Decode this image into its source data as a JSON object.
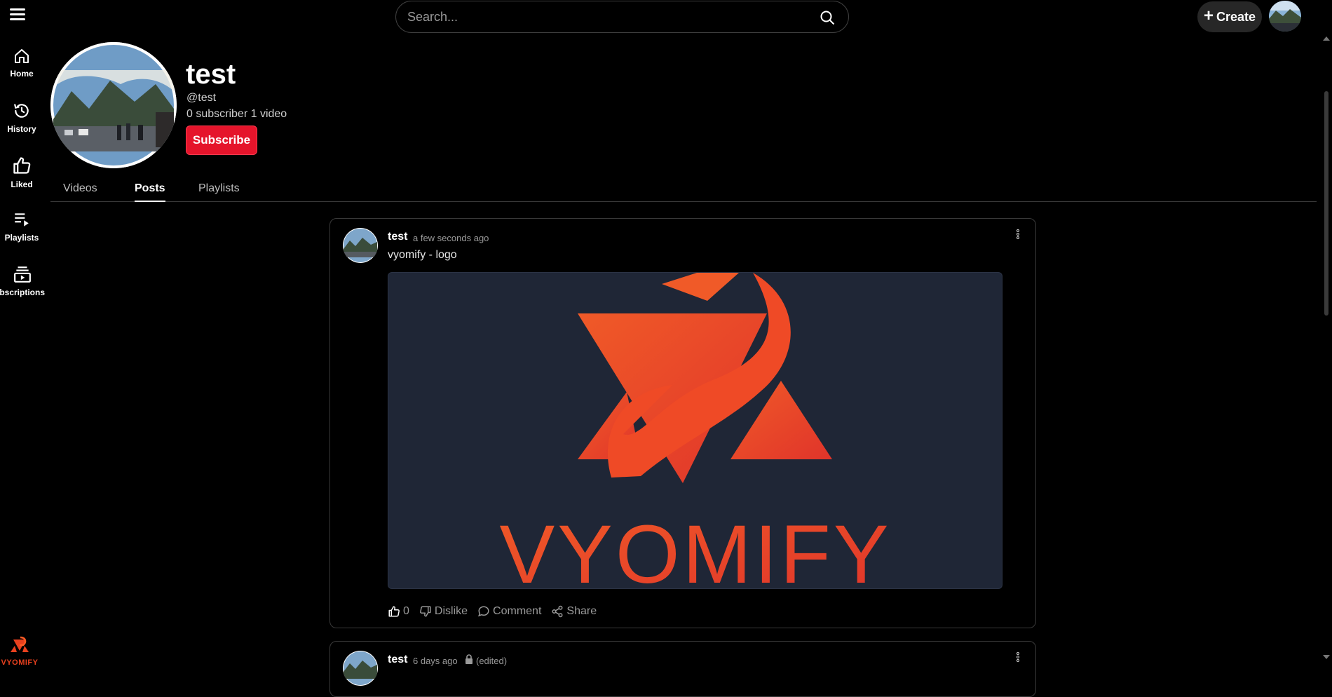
{
  "header": {
    "search_placeholder": "Search...",
    "create_label": "Create"
  },
  "sidebar": {
    "items": [
      {
        "label": "Home",
        "icon": "home-icon"
      },
      {
        "label": "History",
        "icon": "history-icon"
      },
      {
        "label": "Liked",
        "icon": "thumbs-up-icon"
      },
      {
        "label": "Playlists",
        "icon": "playlist-icon"
      },
      {
        "label": "Subscriptions",
        "icon": "subscriptions-icon"
      }
    ],
    "logo_text": "VYOMIFY"
  },
  "channel": {
    "name": "test",
    "handle": "@test",
    "stats": "0 subscriber 1 video",
    "subscribe_label": "Subscribe"
  },
  "tabs": [
    {
      "label": "Videos",
      "active": false
    },
    {
      "label": "Posts",
      "active": true
    },
    {
      "label": "Playlists",
      "active": false
    }
  ],
  "posts": [
    {
      "author": "test",
      "time": "a few seconds ago",
      "text": "vyomify - logo",
      "image_text": "VYOMIFY",
      "likes": "0",
      "dislike_label": "Dislike",
      "comment_label": "Comment",
      "share_label": "Share"
    },
    {
      "author": "test",
      "time": "6 days ago",
      "edited": "(edited)"
    }
  ],
  "colors": {
    "accent_red": "#e5142b",
    "logo_orange": "#e8401e",
    "image_bg": "#1f2636"
  }
}
